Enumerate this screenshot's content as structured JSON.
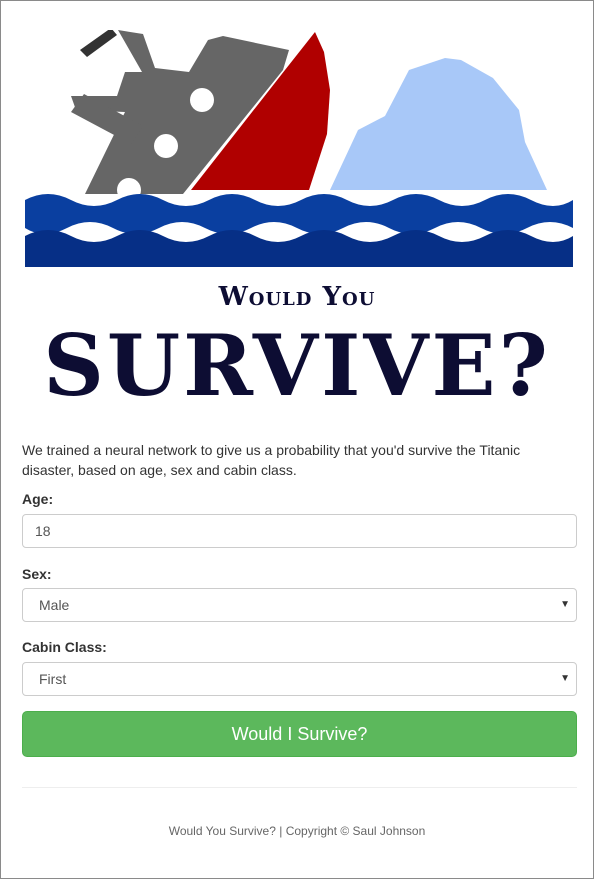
{
  "header": {
    "title_small": "Would You",
    "title_big": "SURVIVE?"
  },
  "intro": {
    "text": "We trained a neural network to give us a probability that you'd survive the Titanic disaster, based on age, sex and cabin class."
  },
  "form": {
    "age": {
      "label": "Age:",
      "value": "18"
    },
    "sex": {
      "label": "Sex:",
      "value": "Male"
    },
    "cabin": {
      "label": "Cabin Class:",
      "value": "First"
    },
    "submit_label": "Would I Survive?"
  },
  "footer": {
    "text": "Would You Survive? | Copyright © Saul Johnson"
  },
  "colors": {
    "ship_gray": "#666666",
    "ship_red": "#b00000",
    "iceberg": "#a8c8f8",
    "wave_light": "#0a3fa0",
    "wave_dark": "#062f86",
    "button": "#5cb85c",
    "title": "#0d0d33"
  },
  "icons": [
    "ship-logo-icon",
    "caret-down-icon"
  ]
}
